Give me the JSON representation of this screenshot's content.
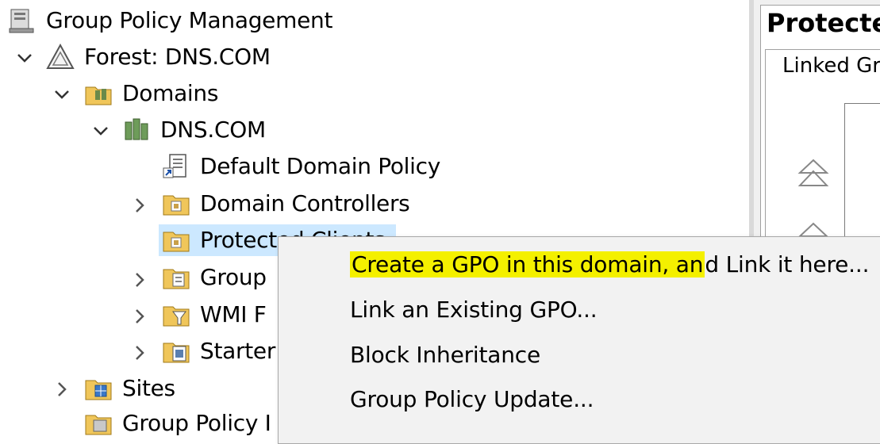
{
  "tree": {
    "root": "Group Policy Management",
    "forest": "Forest: DNS.COM",
    "domains": "Domains",
    "domain": "DNS.COM",
    "default_policy": "Default Domain Policy",
    "domain_controllers": "Domain Controllers",
    "protected_clients": "Protected Clients",
    "group": "Group",
    "wmi": "WMI F",
    "starter": "Starter",
    "sites": "Sites",
    "gpm_partial": "Group Policy I"
  },
  "right_pane": {
    "title": "Protecte",
    "tab_label": "Linked Gr"
  },
  "context_menu": {
    "items": [
      "Create a GPO in this domain, and Link it here...",
      "Link an Existing GPO...",
      "Block Inheritance",
      "Group Policy Update..."
    ],
    "highlight_part": "Create a GPO in this domain, an",
    "rest_part": "d Link it here...",
    "highlight_color": "#f4f000"
  }
}
